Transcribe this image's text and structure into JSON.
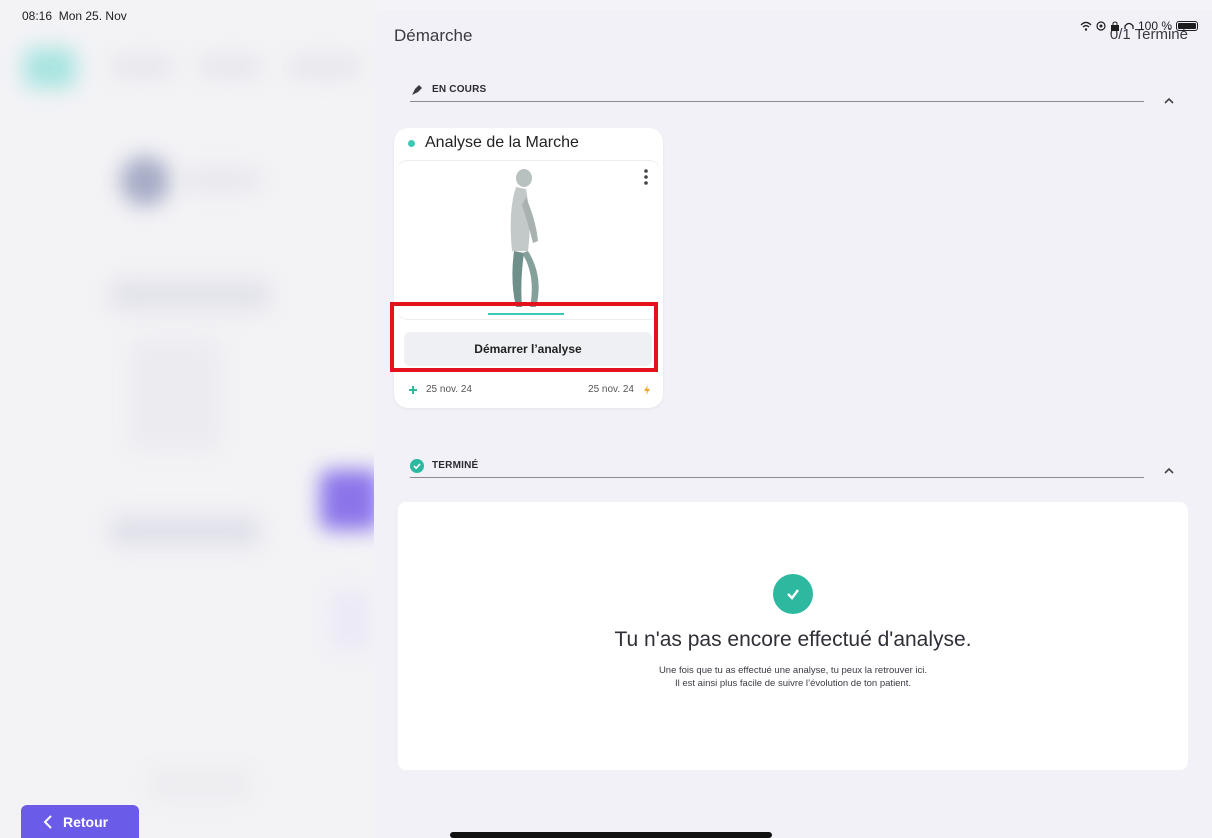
{
  "status_bar": {
    "time": "08:16",
    "date": "Mon 25. Nov",
    "battery": "100 %"
  },
  "panel": {
    "title": "Démarche",
    "progress_text": "0/1 Terminé"
  },
  "section_in_progress": {
    "label": "EN COURS",
    "icon": "pin-icon"
  },
  "analysis_card": {
    "title": "Analyse de la Marche",
    "status_dot_color": "#3ec8b6",
    "start_button_label": "Démarrer l’analyse",
    "created_date": "25 nov. 24",
    "updated_date": "25 nov. 24"
  },
  "section_done": {
    "label": "TERMINÉ",
    "icon": "check-circle-icon"
  },
  "empty_state": {
    "title": "Tu n'as pas encore effectué d'analyse.",
    "line1": "Une fois que tu as effectué une analyse, tu peux la retrouver ici.",
    "line2": "Il est ainsi plus facile de suivre l’évolution de ton patient."
  },
  "back_button": {
    "label": "Retour"
  },
  "colors": {
    "accent_teal": "#2db9a0",
    "accent_purple": "#6a5be8",
    "highlight_red": "#e3121c",
    "orange": "#f5a623"
  }
}
